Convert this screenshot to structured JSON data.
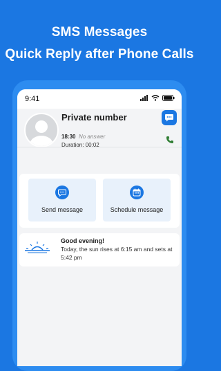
{
  "headline": {
    "line1": "SMS Messages",
    "line2": "Quick Reply after Phone Calls"
  },
  "status_bar": {
    "time": "9:41",
    "icons": [
      "signal-icon",
      "wifi-icon",
      "battery-icon"
    ]
  },
  "caller": {
    "name": "Private number",
    "call_time": "18:30",
    "call_status": "No answer",
    "duration_label": "Duration:",
    "duration_value": "00:02"
  },
  "tabs": [
    {
      "icon": "list-icon",
      "active": true
    },
    {
      "icon": "chat-icon",
      "active": false
    },
    {
      "icon": "bell-icon",
      "active": false
    },
    {
      "icon": "more-icon",
      "active": false
    }
  ],
  "actions": [
    {
      "label": "Send message",
      "icon": "chat-bubble-icon"
    },
    {
      "label": "Schedule message",
      "icon": "calendar-icon"
    }
  ],
  "greeting": {
    "title": "Good evening!",
    "text": "Today, the sun rises at 6:15 am and sets at 5:42 pm",
    "icon": "sunset-icon"
  },
  "colors": {
    "brand": "#1b77e2",
    "phone_frame": "#2d8cf0",
    "call_green": "#2e7d32"
  }
}
